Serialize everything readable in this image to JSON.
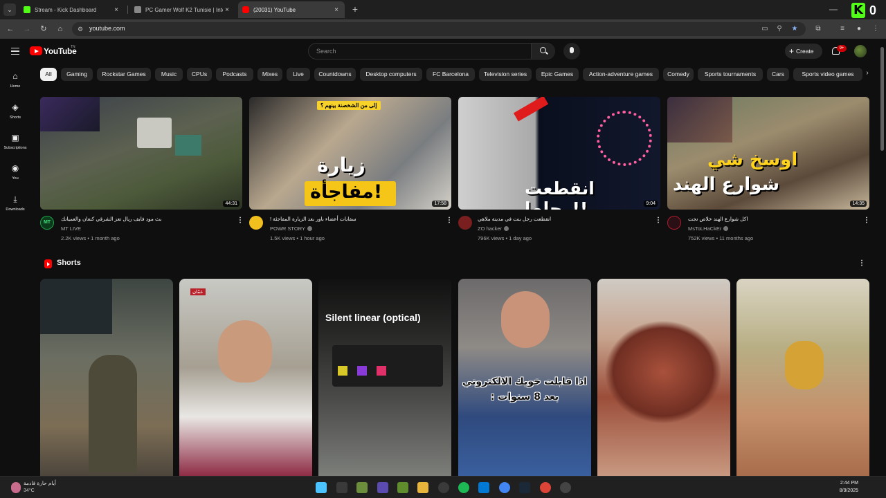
{
  "browser": {
    "tabs": [
      {
        "title": "Stream - Kick Dashboard"
      },
      {
        "title": "PC Gamer Wolf K2 Tunisie | Inte"
      },
      {
        "title": "(20031) YouTube"
      }
    ],
    "new_tab_label": "+",
    "url": "youtube.com"
  },
  "corner_brand": {
    "letter": "K",
    "digit": "0"
  },
  "youtube": {
    "logo_text": "YouTube",
    "country_code": "TN",
    "search_placeholder": "Search",
    "create_label": "Create",
    "notification_count": "9+"
  },
  "rail": [
    {
      "label": "Home",
      "icon": "home-icon"
    },
    {
      "label": "Shorts",
      "icon": "shorts-icon"
    },
    {
      "label": "Subscriptions",
      "icon": "subscriptions-icon"
    },
    {
      "label": "You",
      "icon": "you-icon"
    },
    {
      "label": "Downloads",
      "icon": "downloads-icon"
    }
  ],
  "chips": [
    "All",
    "Gaming",
    "Rockstar Games",
    "Music",
    "CPUs",
    "Podcasts",
    "Mixes",
    "Live",
    "Countdowns",
    "Desktop computers",
    "FC Barcelona",
    "Television series",
    "Epic Games",
    "Action-adventure games",
    "Comedy",
    "Sports tournaments",
    "Cars",
    "Sports video games"
  ],
  "videos": [
    {
      "title": "بث مود فايف ريال تعز الشرقي كنعان والعميانك",
      "channel": "MT LIVE",
      "views": "2.2K views",
      "age": "1 month ago",
      "duration": "44:31",
      "avatar_text": "MT",
      "verified": false
    },
    {
      "title": "سفايات أعضاء باور بعد الزيارة المفاجئة !",
      "channel": "POWR STORY",
      "views": "1.5K views",
      "age": "1 hour ago",
      "duration": "17:58",
      "avatar_text": "",
      "verified": true,
      "thumb_text_1": "زيارة",
      "thumb_text_2": "مفاجأة!",
      "thumb_tag": "إلى من الشخصنة بينهم ؟"
    },
    {
      "title": "انقطعت رجل بنت في مدينة ملاهي",
      "channel": "ZO hacker",
      "views": "796K views",
      "age": "1 day ago",
      "duration": "9:04",
      "avatar_text": "",
      "verified": true,
      "thumb_text_1": "انقطعت رجلها!!"
    },
    {
      "title": "اكل شوارع الهند خلاص نجت",
      "channel": "MsToLHaCkEr",
      "views": "752K views",
      "age": "11 months ago",
      "duration": "14:35",
      "avatar_text": "",
      "verified": true,
      "thumb_text_1": "اوسخ شي",
      "thumb_text_2": "شوارع الهند"
    }
  ],
  "shorts": {
    "title": "Shorts",
    "items": [
      {
        "overlay": ""
      },
      {
        "overlay": "عمّان"
      },
      {
        "overlay": "Silent linear (optical)"
      },
      {
        "overlay": "اذا قابلت خويك الالكتروني بعد 8 سنوات :"
      },
      {
        "overlay": ""
      },
      {
        "overlay": ""
      }
    ]
  },
  "taskbar": {
    "weather_text": "أيام حارة قادمة",
    "temperature": "34°C",
    "time": "2:44 PM",
    "date": "8/9/2025"
  }
}
